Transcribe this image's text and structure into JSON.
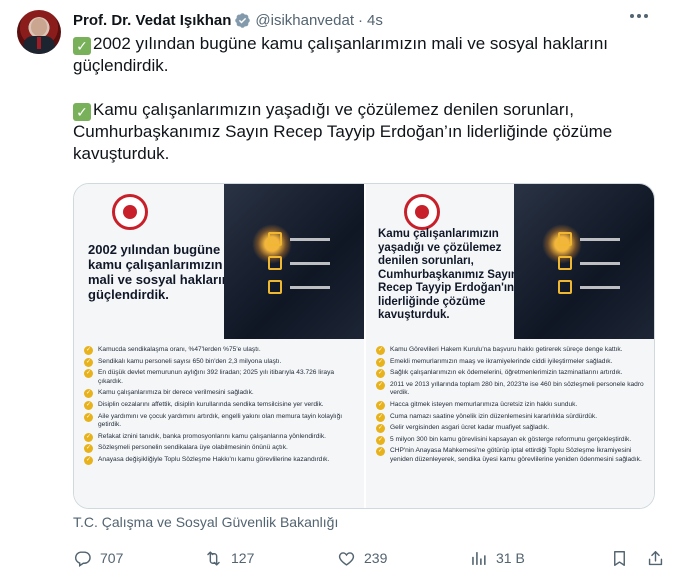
{
  "author": {
    "name": "Prof. Dr. Vedat Işıkhan",
    "handle": "@isikhanvedat",
    "separator": "·",
    "time": "4s"
  },
  "tweet": {
    "paragraphs": [
      "2002 yılından bugüne kamu çalışanlarımızın mali ve sosyal haklarını güçlendirdik.",
      "Kamu çalışanlarımızın yaşadığı ve çözülemez denilen sorunları, Cumhurbaşkanımız Sayın Recep Tayyip Erdoğan’ın liderliğinde çözüme kavuşturduk."
    ],
    "emoji": "✓"
  },
  "media": {
    "left": {
      "headline": "2002 yılından bugüne kamu çalışanlarımızın mali ve sosyal haklarını güçlendirdik.",
      "bullets": [
        "Kamucda sendikalaşma oranı, %47'lerden %75'e ulaştı.",
        "Sendikalı kamu personeli sayısı 650 bin'den 2,3 milyona ulaştı.",
        "En düşük devlet memurunun aylığını 392 liradan; 2025 yılı itibarıyla 43.726 liraya çıkardık.",
        "Kamu çalışanlarımıza bir derece verilmesini sağladık.",
        "Disiplin cezalarını affettik, disiplin kurullarında sendika temsilcisine yer verdik.",
        "Aile yardımını ve çocuk yardımını artırdık, engelli yakını olan memura tayin kolaylığı getirdik.",
        "Refakat iznini tanıdık, banka promosyonlarını kamu çalışanlarına yönlendirdik.",
        "Sözleşmeli personelin sendikalara üye olabilmesinin önünü açtık.",
        "Anayasa değişikliğiyle Toplu Sözleşme Hakkı'nı kamu görevlilerine kazandırdık."
      ]
    },
    "right": {
      "headline": "Kamu çalışanlarımızın yaşadığı ve çözülemez denilen sorunları, Cumhurbaşkanımız Sayın Recep Tayyip Erdoğan'ın liderliğinde çözüme kavuşturduk.",
      "bullets": [
        "Kamu Görevlileri Hakem Kurulu'na başvuru hakkı getirerek süreçe denge kattık.",
        "Emekli memurlarımızın maaş ve ikramiyelerinde ciddi iyileştirmeler sağladık.",
        "Sağlık çalışanlarımızın ek ödemelerini, öğretmenlerimizin tazminatlarını artırdık.",
        "2011 ve 2013 yıllarında toplam 280 bin, 2023'te ise 460 bin sözleşmeli personele kadro verdik.",
        "Hacca gitmek isteyen memurlarımıza ücretsiz izin hakkı sunduk.",
        "Cuma namazı saatine yönelik izin düzenlemesini kararlılıkla sürdürdük.",
        "Gelir vergisinden asgari ücret kadar muafiyet sağladık.",
        "5 milyon 300 bin kamu görevlisini kapsayan ek gösterge reformunu gerçekleştirdik.",
        "CHP'nin Anayasa Mahkemesi'ne götürüp iptal ettirdiği Toplu Sözleşme İkramiyesini yeniden düzenleyerek, sendika üyesi kamu görevlilerine yeniden ödenmesini sağladık."
      ]
    },
    "caption": "T.C. Çalışma ve Sosyal Güvenlik Bakanlığı"
  },
  "actions": {
    "replies": "707",
    "retweets": "127",
    "likes": "239",
    "views": "31 B"
  },
  "colors": {
    "accent": "#1d9bf0",
    "muted": "#536471",
    "text": "#0f1419",
    "check": "#78b159",
    "bullet": "#e8b21c",
    "brand_red": "#c8202a"
  },
  "icons": [
    "verified-badge-icon",
    "more-icon",
    "reply-icon",
    "retweet-icon",
    "like-icon",
    "views-icon",
    "bookmark-icon",
    "share-icon"
  ]
}
